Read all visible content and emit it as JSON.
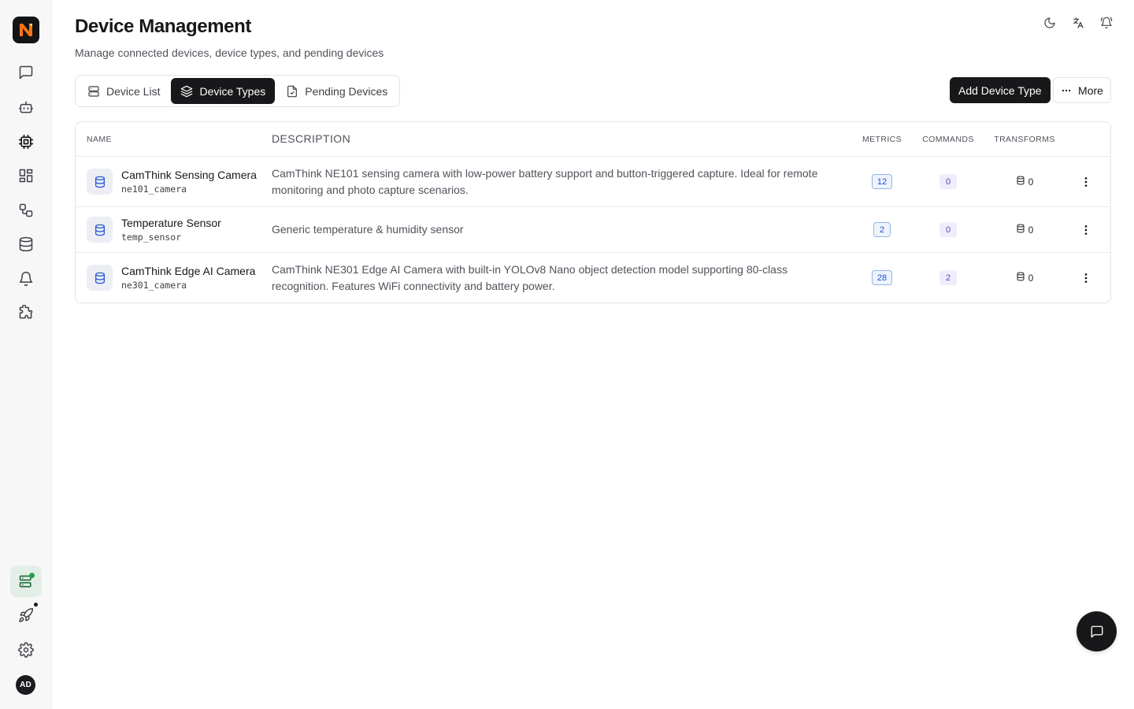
{
  "app": {
    "logo_letter": "N"
  },
  "header": {
    "title": "Device Management",
    "subtitle": "Manage connected devices, device types, and pending devices"
  },
  "tabs": [
    {
      "label": "Device List",
      "icon": "server-icon",
      "active": false
    },
    {
      "label": "Device Types",
      "icon": "layers-icon",
      "active": true
    },
    {
      "label": "Pending Devices",
      "icon": "file-pending-icon",
      "active": false
    }
  ],
  "actions": {
    "primary_label": "Add Device Type",
    "more_label": "More"
  },
  "table": {
    "columns": [
      "NAME",
      "DESCRIPTION",
      "METRICS",
      "COMMANDS",
      "TRANSFORMS"
    ],
    "rows": [
      {
        "name": "CamThink Sensing Camera",
        "code": "ne101_camera",
        "description": "CamThink NE101 sensing camera with low-power battery support and button-triggered capture. Ideal for remote monitoring and photo capture scenarios.",
        "metrics": "12",
        "commands": "0",
        "transforms": "0"
      },
      {
        "name": "Temperature Sensor",
        "code": "temp_sensor",
        "description": "Generic temperature & humidity sensor",
        "metrics": "2",
        "commands": "0",
        "transforms": "0"
      },
      {
        "name": "CamThink Edge AI Camera",
        "code": "ne301_camera",
        "description": "CamThink NE301 Edge AI Camera with built-in YOLOv8 Nano object detection model supporting 80-class recognition. Features WiFi connectivity and battery power.",
        "metrics": "28",
        "commands": "2",
        "transforms": "0"
      }
    ]
  },
  "user": {
    "initials": "AD"
  },
  "colors": {
    "brand_orange": "#f97316",
    "active_green": "#1f6b3a",
    "badge_blue": "#1d4ed8",
    "badge_purple": "#5b45c9"
  }
}
